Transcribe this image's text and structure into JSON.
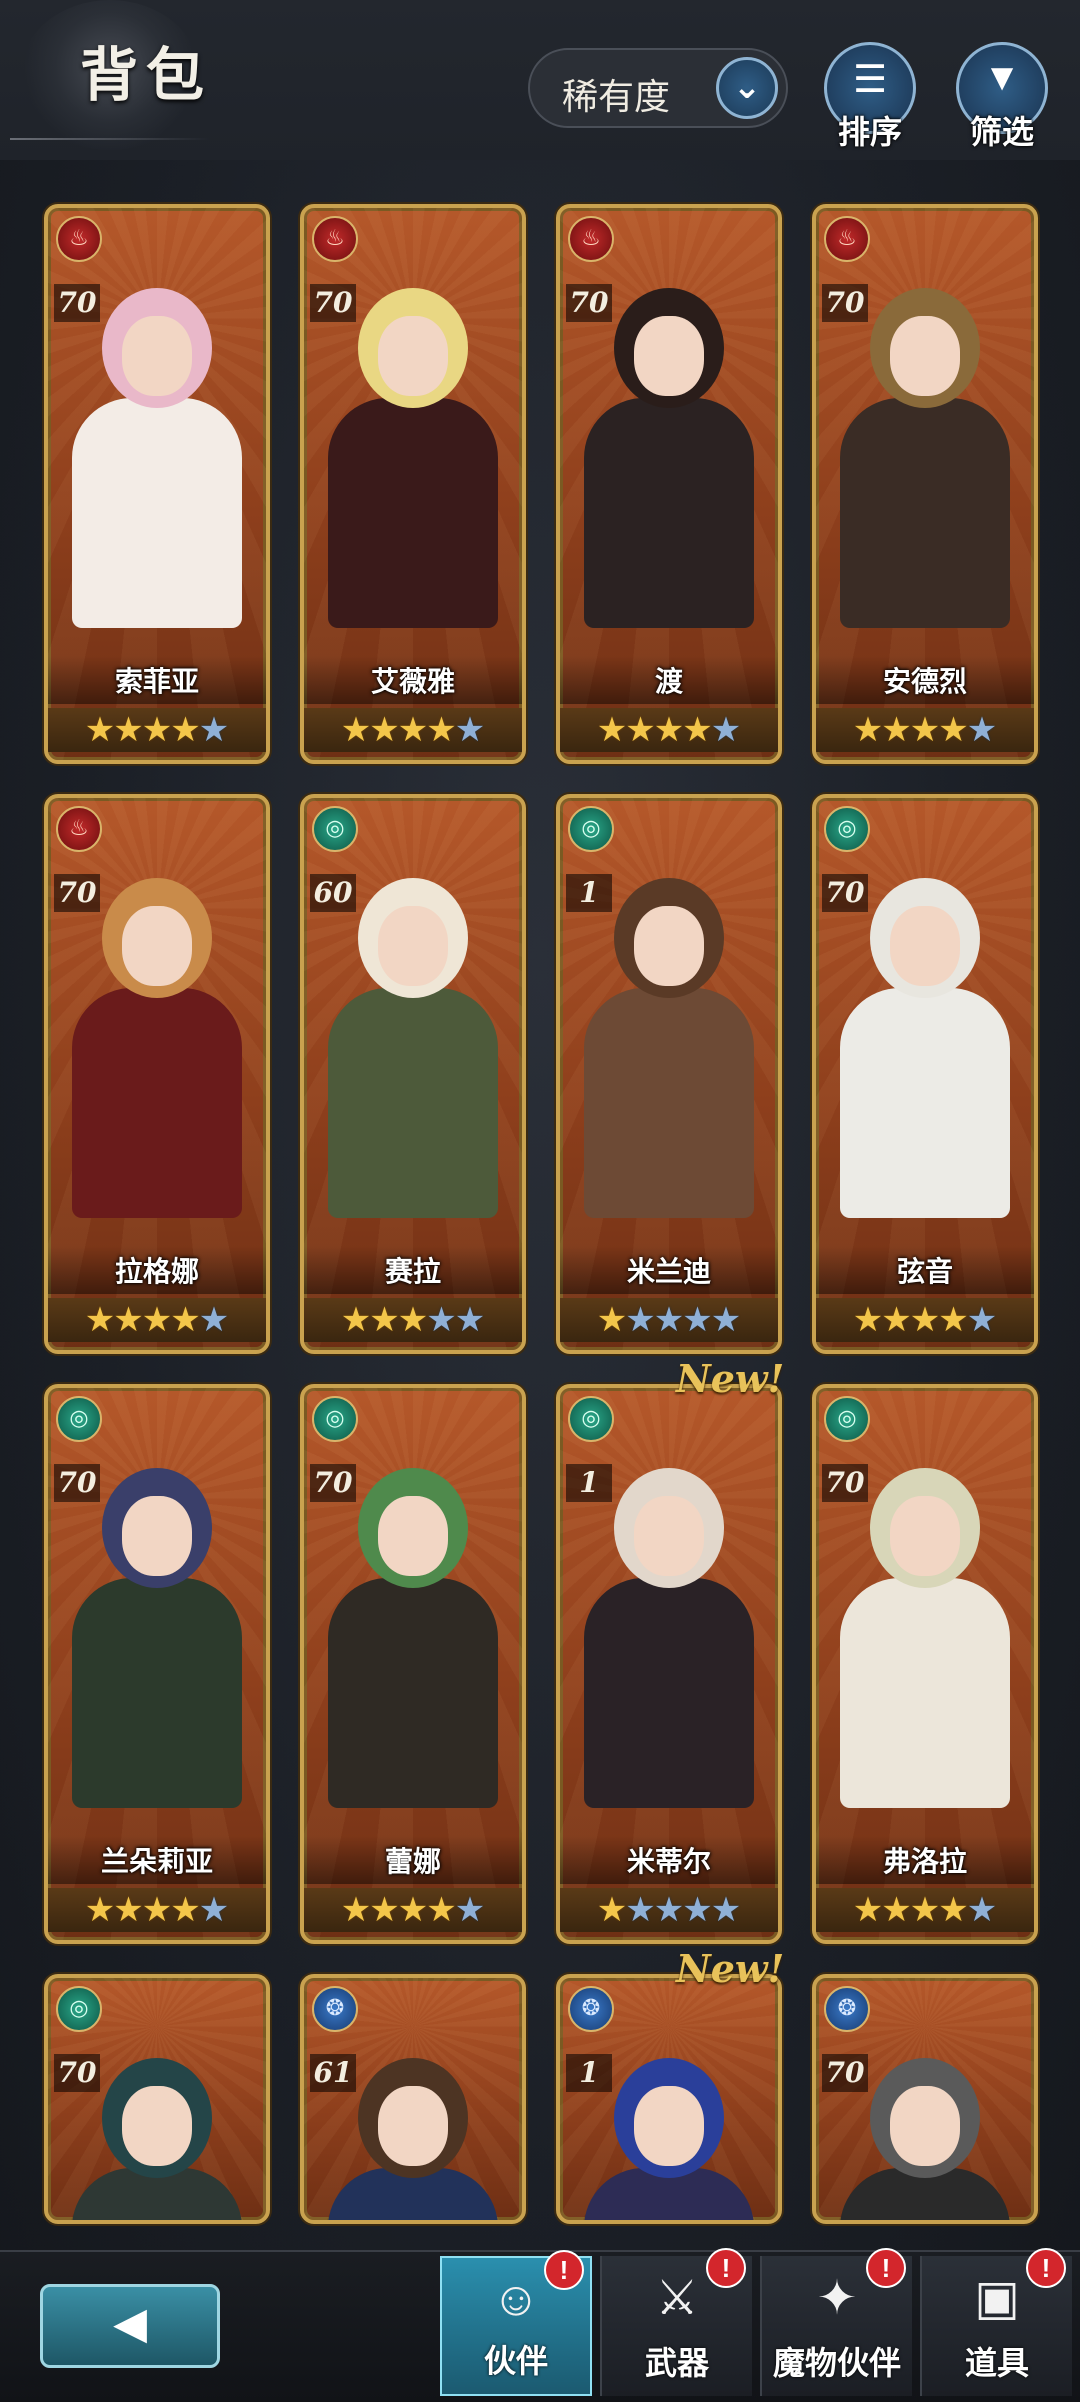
{
  "header": {
    "title": "背包",
    "sort_label": "稀有度",
    "sort_button_label": "排序",
    "filter_button_label": "筛选"
  },
  "cards": [
    {
      "name": "索菲亚",
      "level": "70",
      "element": "fire",
      "stars_on": 4,
      "stars_total": 5,
      "new": false
    },
    {
      "name": "艾薇雅",
      "level": "70",
      "element": "fire",
      "stars_on": 4,
      "stars_total": 5,
      "new": false
    },
    {
      "name": "渡",
      "level": "70",
      "element": "fire",
      "stars_on": 4,
      "stars_total": 5,
      "new": false
    },
    {
      "name": "安德烈",
      "level": "70",
      "element": "fire",
      "stars_on": 4,
      "stars_total": 5,
      "new": false
    },
    {
      "name": "拉格娜",
      "level": "70",
      "element": "fire",
      "stars_on": 4,
      "stars_total": 5,
      "new": false
    },
    {
      "name": "赛拉",
      "level": "60",
      "element": "wind",
      "stars_on": 3,
      "stars_total": 5,
      "new": false
    },
    {
      "name": "米兰迪",
      "level": "1",
      "element": "wind",
      "stars_on": 1,
      "stars_total": 5,
      "new": false
    },
    {
      "name": "弦音",
      "level": "70",
      "element": "wind",
      "stars_on": 4,
      "stars_total": 5,
      "new": false
    },
    {
      "name": "兰朵莉亚",
      "level": "70",
      "element": "wind",
      "stars_on": 4,
      "stars_total": 5,
      "new": false
    },
    {
      "name": "蕾娜",
      "level": "70",
      "element": "wind",
      "stars_on": 4,
      "stars_total": 5,
      "new": false
    },
    {
      "name": "米蒂尔",
      "level": "1",
      "element": "wind",
      "stars_on": 1,
      "stars_total": 5,
      "new": true
    },
    {
      "name": "弗洛拉",
      "level": "70",
      "element": "wind",
      "stars_on": 4,
      "stars_total": 5,
      "new": false
    },
    {
      "name": "",
      "level": "70",
      "element": "wind",
      "stars_on": 0,
      "stars_total": 0,
      "new": false
    },
    {
      "name": "",
      "level": "61",
      "element": "water",
      "stars_on": 0,
      "stars_total": 0,
      "new": false
    },
    {
      "name": "",
      "level": "1",
      "element": "water",
      "stars_on": 0,
      "stars_total": 0,
      "new": true
    },
    {
      "name": "",
      "level": "70",
      "element": "water",
      "stars_on": 0,
      "stars_total": 0,
      "new": false
    }
  ],
  "new_label": "New!",
  "tabs": [
    {
      "label": "伙伴",
      "icon": "companion-icon",
      "active": true,
      "badge": "!"
    },
    {
      "label": "武器",
      "icon": "weapons-icon",
      "active": false,
      "badge": "!"
    },
    {
      "label": "魔物伙伴",
      "icon": "monster-icon",
      "active": false,
      "badge": "!"
    },
    {
      "label": "道具",
      "icon": "items-icon",
      "active": false,
      "badge": "!"
    }
  ],
  "colors": {
    "card_frame": "#c9a24f",
    "card_bg": "#a24c22",
    "fire": "#c22a2a",
    "wind": "#2aa88a",
    "water": "#3a7ac9",
    "star_on": "#f3c64a",
    "star_off": "#8fb0d6",
    "active_tab": "#2a8fae"
  }
}
